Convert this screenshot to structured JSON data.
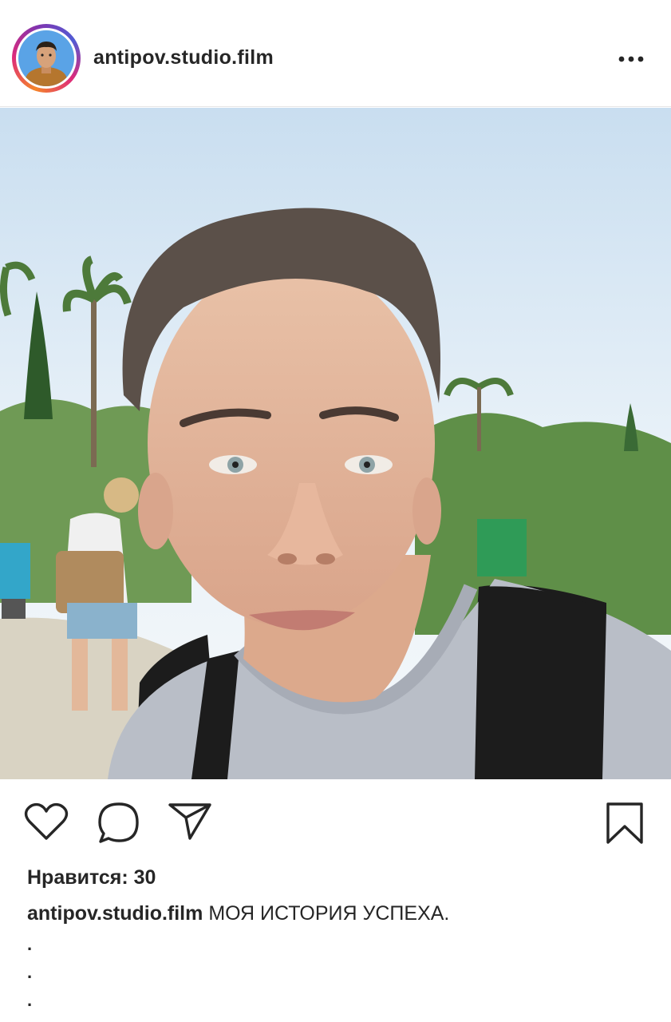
{
  "post": {
    "username": "antipov.studio.film",
    "likes_text": "Нравится: 30",
    "caption_user": "antipov.studio.film",
    "caption_text": "МОЯ ИСТОРИЯ УСПЕХА.",
    "caption_dots": [
      ".",
      ".",
      "."
    ]
  },
  "icons": {
    "more": "more-options-icon",
    "like": "heart-icon",
    "comment": "comment-icon",
    "share": "send-icon",
    "save": "bookmark-icon"
  },
  "colors": {
    "text": "#262626",
    "story_ring": [
      "#f58529",
      "#dd2a7b",
      "#8134af",
      "#515bd4"
    ]
  }
}
